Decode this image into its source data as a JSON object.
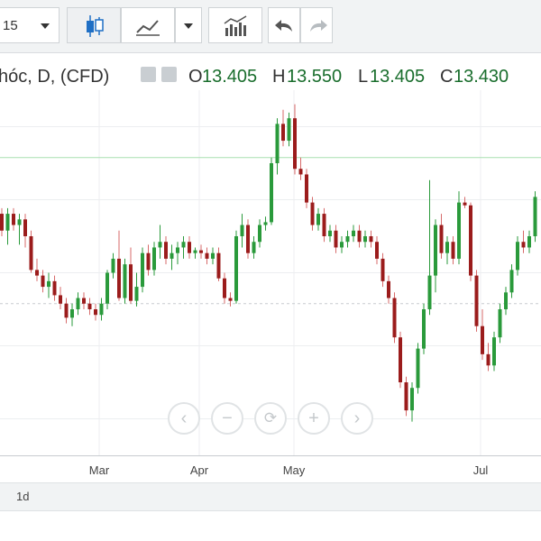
{
  "toolbar": {
    "interval_value": "15",
    "chart_type_icon": "candlestick-icon",
    "line_icon": "line-chart-icon",
    "indicators_icon": "indicators-icon",
    "undo_icon": "undo-icon",
    "redo_icon": "redo-icon"
  },
  "legend": {
    "symbol": "hóc, D, (CFD)",
    "o_label": "O",
    "o_value": "13.405",
    "h_label": "H",
    "h_value": "13.550",
    "l_label": "L",
    "l_value": "13.405",
    "c_label": "C",
    "c_value": "13.430"
  },
  "x_axis": {
    "ticks": [
      "Mar",
      "Apr",
      "May",
      "Jul"
    ]
  },
  "zoom": {
    "back": "‹",
    "out": "−",
    "reset": "⟳",
    "in": "+",
    "forward": "›"
  },
  "bottom": {
    "range": "1d"
  },
  "colors": {
    "up": "#2a9a3b",
    "down": "#9b1c1c",
    "wick": "#d76a6a",
    "grid": "#eceef0",
    "hline": "#a8dfb0"
  },
  "chart_data": {
    "type": "candlestick",
    "ylim": [
      12.3,
      13.6
    ],
    "x_ticks": [
      "Mar",
      "Apr",
      "May",
      "Jul"
    ],
    "reference_line": 13.36,
    "series": [
      [
        0,
        13.16,
        13.18,
        13.08,
        13.1
      ],
      [
        1,
        13.1,
        13.18,
        13.05,
        13.16
      ],
      [
        2,
        13.16,
        13.18,
        13.1,
        13.12
      ],
      [
        3,
        13.12,
        13.16,
        13.05,
        13.14
      ],
      [
        4,
        13.14,
        13.16,
        13.04,
        13.08
      ],
      [
        5,
        13.08,
        13.1,
        12.95,
        12.96
      ],
      [
        6,
        12.96,
        13.0,
        12.92,
        12.94
      ],
      [
        7,
        12.94,
        12.96,
        12.88,
        12.9
      ],
      [
        8,
        12.9,
        12.95,
        12.86,
        12.92
      ],
      [
        9,
        12.92,
        12.94,
        12.85,
        12.87
      ],
      [
        10,
        12.87,
        12.9,
        12.82,
        12.84
      ],
      [
        11,
        12.84,
        12.86,
        12.77,
        12.79
      ],
      [
        12,
        12.79,
        12.84,
        12.76,
        12.82
      ],
      [
        13,
        12.82,
        12.88,
        12.8,
        12.86
      ],
      [
        14,
        12.86,
        12.88,
        12.82,
        12.84
      ],
      [
        15,
        12.84,
        12.86,
        12.8,
        12.82
      ],
      [
        16,
        12.82,
        12.84,
        12.78,
        12.8
      ],
      [
        17,
        12.8,
        12.86,
        12.78,
        12.84
      ],
      [
        18,
        12.84,
        12.96,
        12.82,
        12.95
      ],
      [
        19,
        12.95,
        13.02,
        12.93,
        13.0
      ],
      [
        20,
        13.0,
        13.1,
        12.85,
        12.86
      ],
      [
        21,
        12.86,
        13.0,
        12.84,
        12.98
      ],
      [
        22,
        12.98,
        13.04,
        12.84,
        12.85
      ],
      [
        23,
        12.85,
        12.95,
        12.83,
        12.9
      ],
      [
        24,
        12.9,
        13.04,
        12.88,
        13.02
      ],
      [
        25,
        13.02,
        13.05,
        12.94,
        12.96
      ],
      [
        26,
        12.96,
        13.06,
        12.94,
        13.04
      ],
      [
        27,
        13.04,
        13.12,
        13.0,
        13.06
      ],
      [
        28,
        13.06,
        13.08,
        12.98,
        13.0
      ],
      [
        29,
        13.0,
        13.05,
        12.96,
        13.02
      ],
      [
        30,
        13.02,
        13.06,
        12.98,
        13.04
      ],
      [
        31,
        13.04,
        13.08,
        13.0,
        13.06
      ],
      [
        32,
        13.06,
        13.08,
        13.0,
        13.02
      ],
      [
        33,
        13.02,
        13.04,
        13.0,
        13.03
      ],
      [
        34,
        13.03,
        13.05,
        13.0,
        13.02
      ],
      [
        35,
        13.02,
        13.04,
        12.98,
        13.0
      ],
      [
        36,
        13.0,
        13.04,
        12.98,
        13.02
      ],
      [
        37,
        13.02,
        13.04,
        12.92,
        12.93
      ],
      [
        38,
        12.93,
        12.95,
        12.84,
        12.86
      ],
      [
        39,
        12.86,
        12.88,
        12.83,
        12.85
      ],
      [
        40,
        12.85,
        13.1,
        12.84,
        13.08
      ],
      [
        41,
        13.08,
        13.16,
        13.04,
        13.12
      ],
      [
        42,
        13.12,
        13.14,
        13.0,
        13.02
      ],
      [
        43,
        13.02,
        13.08,
        13.0,
        13.06
      ],
      [
        44,
        13.06,
        13.14,
        13.04,
        13.12
      ],
      [
        45,
        13.12,
        13.15,
        13.1,
        13.13
      ],
      [
        46,
        13.13,
        13.36,
        13.12,
        13.34
      ],
      [
        47,
        13.34,
        13.5,
        13.3,
        13.48
      ],
      [
        48,
        13.48,
        13.53,
        13.4,
        13.42
      ],
      [
        49,
        13.42,
        13.52,
        13.4,
        13.5
      ],
      [
        50,
        13.5,
        13.55,
        13.3,
        13.32
      ],
      [
        51,
        13.32,
        13.36,
        13.28,
        13.3
      ],
      [
        52,
        13.3,
        13.32,
        13.18,
        13.2
      ],
      [
        53,
        13.2,
        13.22,
        13.1,
        13.12
      ],
      [
        54,
        13.12,
        13.18,
        13.1,
        13.16
      ],
      [
        55,
        13.16,
        13.18,
        13.06,
        13.08
      ],
      [
        56,
        13.08,
        13.12,
        13.06,
        13.1
      ],
      [
        57,
        13.1,
        13.12,
        13.02,
        13.04
      ],
      [
        58,
        13.04,
        13.08,
        13.02,
        13.06
      ],
      [
        59,
        13.06,
        13.1,
        13.04,
        13.08
      ],
      [
        60,
        13.08,
        13.12,
        13.06,
        13.1
      ],
      [
        61,
        13.1,
        13.12,
        13.04,
        13.06
      ],
      [
        62,
        13.06,
        13.1,
        13.04,
        13.08
      ],
      [
        63,
        13.08,
        13.1,
        13.04,
        13.06
      ],
      [
        64,
        13.06,
        13.08,
        12.98,
        13.0
      ],
      [
        65,
        13.0,
        13.02,
        12.9,
        12.92
      ],
      [
        66,
        12.92,
        12.94,
        12.84,
        12.86
      ],
      [
        67,
        12.86,
        12.88,
        12.7,
        12.72
      ],
      [
        68,
        12.72,
        12.74,
        12.54,
        12.56
      ],
      [
        69,
        12.56,
        12.58,
        12.44,
        12.46
      ],
      [
        70,
        12.46,
        12.56,
        12.42,
        12.54
      ],
      [
        71,
        12.54,
        12.7,
        12.52,
        12.68
      ],
      [
        72,
        12.68,
        12.84,
        12.66,
        12.82
      ],
      [
        73,
        12.82,
        13.28,
        12.8,
        12.94
      ],
      [
        74,
        12.94,
        13.14,
        12.88,
        13.12
      ],
      [
        75,
        13.12,
        13.16,
        13.0,
        13.02
      ],
      [
        76,
        13.02,
        13.08,
        12.98,
        13.06
      ],
      [
        77,
        13.06,
        13.08,
        12.98,
        13.0
      ],
      [
        78,
        13.0,
        13.24,
        12.98,
        13.2
      ],
      [
        79,
        13.2,
        13.22,
        13.18,
        13.19
      ],
      [
        80,
        13.19,
        13.2,
        12.92,
        12.94
      ],
      [
        81,
        12.94,
        12.96,
        12.74,
        12.76
      ],
      [
        82,
        12.76,
        12.82,
        12.64,
        12.66
      ],
      [
        83,
        12.66,
        12.7,
        12.6,
        12.62
      ],
      [
        84,
        12.62,
        12.74,
        12.6,
        12.72
      ],
      [
        85,
        12.72,
        12.84,
        12.7,
        12.82
      ],
      [
        86,
        12.82,
        12.9,
        12.8,
        12.88
      ],
      [
        87,
        12.88,
        12.98,
        12.86,
        12.96
      ],
      [
        88,
        12.96,
        13.08,
        12.94,
        13.06
      ],
      [
        89,
        13.06,
        13.1,
        13.02,
        13.04
      ],
      [
        90,
        13.04,
        13.1,
        13.02,
        13.08
      ],
      [
        91,
        13.08,
        13.24,
        13.06,
        13.22
      ]
    ]
  }
}
